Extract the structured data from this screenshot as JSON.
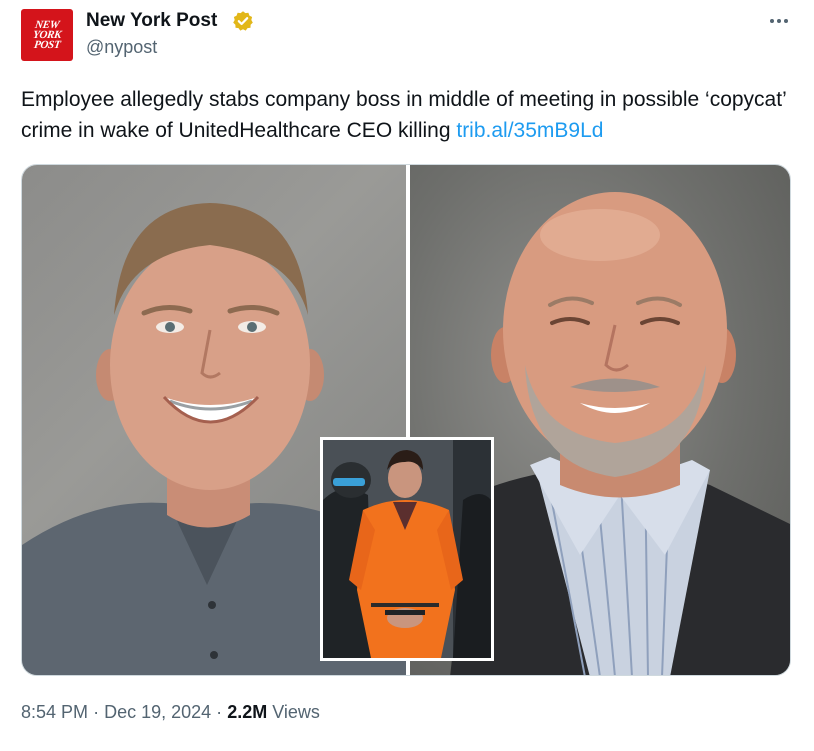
{
  "author": {
    "logo_lines": [
      "NEW",
      "YORK",
      "POST"
    ],
    "display_name": "New York Post",
    "handle": "@nypost",
    "verified_icon": "gold-verified-badge",
    "avatar_color": "#d4141b"
  },
  "more_icon": "ellipsis-horizontal",
  "tweet": {
    "text": "Employee allegedly stabs company boss in middle of meeting in possible ‘copycat’ crime in wake of UnitedHealthcare CEO killing",
    "link": "trib.al/35mB9Ld",
    "link_color": "#1d9bf0"
  },
  "meta": {
    "time": "8:54 PM",
    "separator": "·",
    "date": "Dec 19, 2024",
    "views_count": "2.2M",
    "views_label": "Views"
  }
}
